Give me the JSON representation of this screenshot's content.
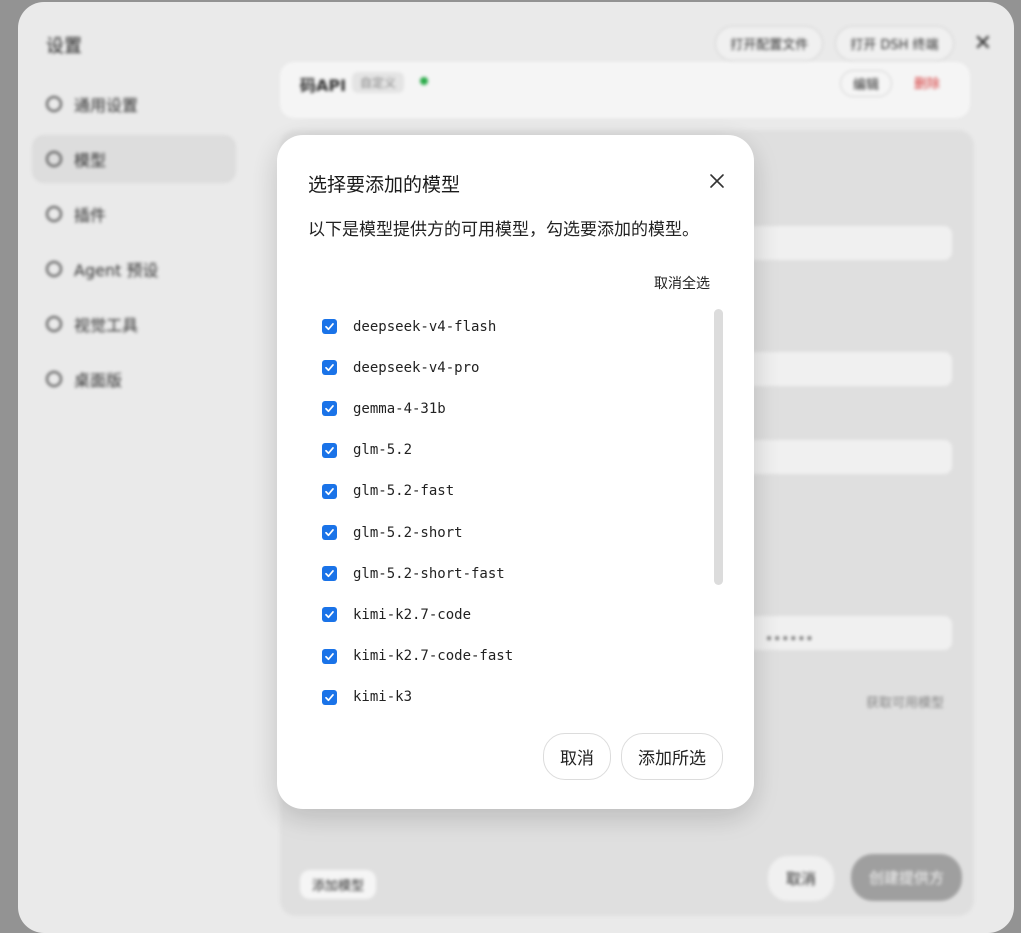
{
  "settings": {
    "title": "设置",
    "top_actions": [
      "打开配置文件",
      "打开 DSH 终端"
    ],
    "nav": [
      {
        "label": "通用设置",
        "icon": "gear-icon"
      },
      {
        "label": "模型",
        "icon": "model-icon",
        "active": true
      },
      {
        "label": "插件",
        "icon": "plugin-icon"
      },
      {
        "label": "Agent 预设",
        "icon": "agent-icon"
      },
      {
        "label": "视觉工具",
        "icon": "eye-icon"
      },
      {
        "label": "桌面版",
        "icon": "desktop-icon"
      }
    ],
    "provider": {
      "name": "码API",
      "tag": "自定义",
      "edit": "编辑",
      "delete": "删除"
    },
    "masked_key": "••••••",
    "fetch_models": "获取可用模型",
    "add_model": "添加模型",
    "cancel": "取消",
    "create": "创建提供方"
  },
  "dialog": {
    "title": "选择要添加的模型",
    "description": "以下是模型提供方的可用模型，勾选要添加的模型。",
    "deselect_all": "取消全选",
    "models": [
      {
        "name": "deepseek-v4-flash",
        "checked": true
      },
      {
        "name": "deepseek-v4-pro",
        "checked": true
      },
      {
        "name": "gemma-4-31b",
        "checked": true
      },
      {
        "name": "glm-5.2",
        "checked": true
      },
      {
        "name": "glm-5.2-fast",
        "checked": true
      },
      {
        "name": "glm-5.2-short",
        "checked": true
      },
      {
        "name": "glm-5.2-short-fast",
        "checked": true
      },
      {
        "name": "kimi-k2.7-code",
        "checked": true
      },
      {
        "name": "kimi-k2.7-code-fast",
        "checked": true
      },
      {
        "name": "kimi-k3",
        "checked": true
      }
    ],
    "cancel_label": "取消",
    "confirm_label": "添加所选"
  },
  "colors": {
    "checkbox": "#1a73e8",
    "status_ok": "#2bb24c",
    "danger": "#e04040"
  }
}
